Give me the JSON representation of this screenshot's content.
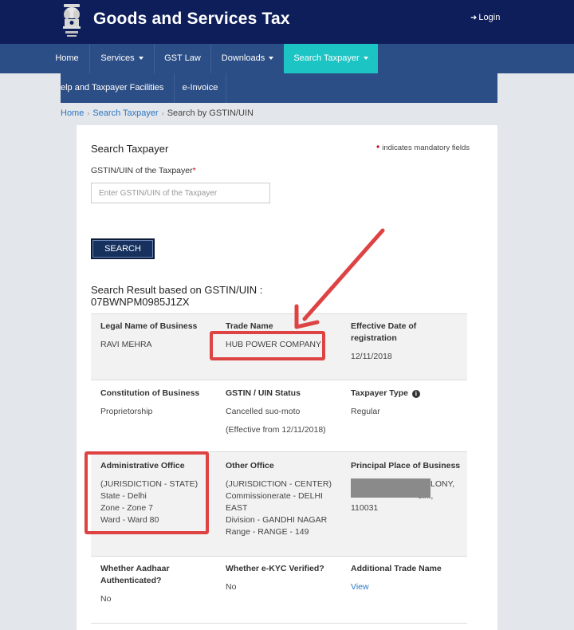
{
  "header": {
    "site_title": "Goods and Services Tax",
    "login_label": "Login"
  },
  "nav": {
    "primary": [
      {
        "label": "Home"
      },
      {
        "label": "Services"
      },
      {
        "label": "GST Law"
      },
      {
        "label": "Downloads"
      },
      {
        "label": "Search Taxpayer"
      }
    ],
    "secondary": [
      {
        "label": "elp and Taxpayer Facilities"
      },
      {
        "label": "e-Invoice"
      }
    ]
  },
  "breadcrumb": {
    "home": "Home",
    "search_taxpayer": "Search Taxpayer",
    "current": "Search by GSTIN/UIN"
  },
  "form": {
    "title": "Search Taxpayer",
    "mandatory_note": "indicates mandatory fields",
    "gstin_label": "GSTIN/UIN of the Taxpayer",
    "gstin_placeholder": "Enter GSTIN/UIN of the Taxpayer",
    "search_button": "SEARCH"
  },
  "result": {
    "heading_line1": "Search Result based on GSTIN/UIN :",
    "heading_line2": "07BWNPM0985J1ZX",
    "legal_name_label": "Legal Name of Business",
    "legal_name_value": "RAVI MEHRA",
    "trade_name_label": "Trade Name",
    "trade_name_value": "HUB POWER COMPANY",
    "effective_date_label_1": "Effective Date of",
    "effective_date_label_2": "registration",
    "effective_date_value": "12/11/2018",
    "constitution_label": "Constitution of Business",
    "constitution_value": "Proprietorship",
    "status_label": "GSTIN / UIN Status",
    "status_value": "Cancelled suo-moto",
    "status_effective": "(Effective from 12/11/2018)",
    "taxpayer_type_label": "Taxpayer Type",
    "taxpayer_type_value": "Regular",
    "admin_office_label": "Administrative Office",
    "admin_office_lines": [
      "(JURISDICTION - STATE)",
      "State - Delhi",
      "Zone - Zone 7",
      "Ward - Ward 80"
    ],
    "other_office_label": "Other Office",
    "other_office_lines": [
      "(JURISDICTION - CENTER)",
      "Commissionerate - DELHI",
      "EAST",
      "Division - GANDHI NAGAR",
      "Range - RANGE - 149"
    ],
    "ppob_label": "Principal Place of Business",
    "ppob_line1": "LONY,",
    "ppob_line2": "elhi,",
    "ppob_line3": "110031",
    "aadhaar_label_1": "Whether Aadhaar",
    "aadhaar_label_2": "Authenticated?",
    "aadhaar_value": "No",
    "ekyc_label": "Whether e-KYC Verified?",
    "ekyc_value": "No",
    "additional_trade_label": "Additional Trade Name",
    "additional_trade_link": "View"
  },
  "colors": {
    "header_bg": "#0e1e5b",
    "nav_bg": "#2c4e86",
    "nav_active": "#1dc4c4",
    "annotation_red": "#de4343",
    "link": "#2b77c4"
  }
}
